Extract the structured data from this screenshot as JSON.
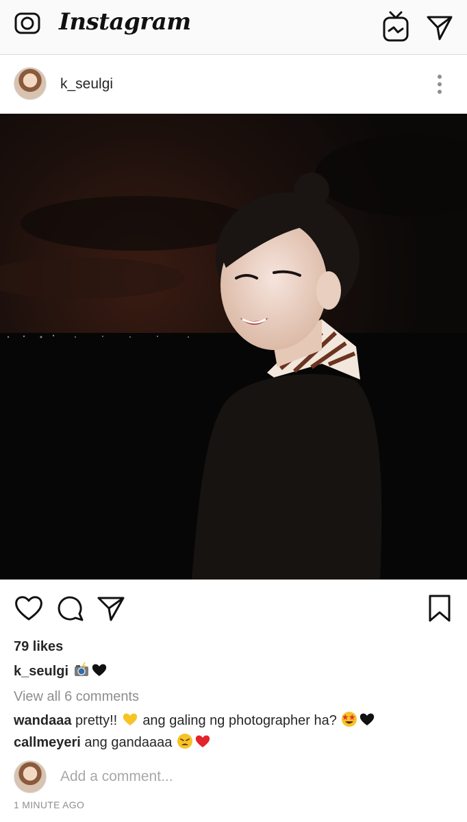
{
  "app": {
    "logo_text": "Instagram"
  },
  "icons": {
    "camera": "camera-icon",
    "igtv": "igtv-icon",
    "direct": "direct-message-icon",
    "more": "more-options-icon",
    "like": "heart-icon",
    "comment": "comment-icon",
    "share": "share-icon",
    "save": "bookmark-icon"
  },
  "post": {
    "username": "k_seulgi",
    "likes": "79 likes",
    "caption": {
      "username": "k_seulgi",
      "text": "",
      "emojis": [
        "camera-with-flash",
        "black-heart"
      ]
    },
    "view_all_comments": "View all 6 comments",
    "comments": [
      {
        "username": "wandaaa",
        "text_a": "pretty!!",
        "text_b": "ang galing ng photographer ha?",
        "emojis_a": [
          "yellow-heart"
        ],
        "emojis_b": [
          "star-struck",
          "black-heart"
        ]
      },
      {
        "username": "callmeyeri",
        "text_a": "ang gandaaaa",
        "emojis_a": [
          "weary-face",
          "red-heart"
        ]
      }
    ],
    "add_comment_placeholder": "Add a comment...",
    "timestamp": "1 MINUTE AGO"
  },
  "colors": {
    "text": "#262626",
    "muted": "#8e8e8e",
    "placeholder": "#a8a8a8",
    "topbar_bg": "#fafafa",
    "divider": "#dbdbdb"
  }
}
